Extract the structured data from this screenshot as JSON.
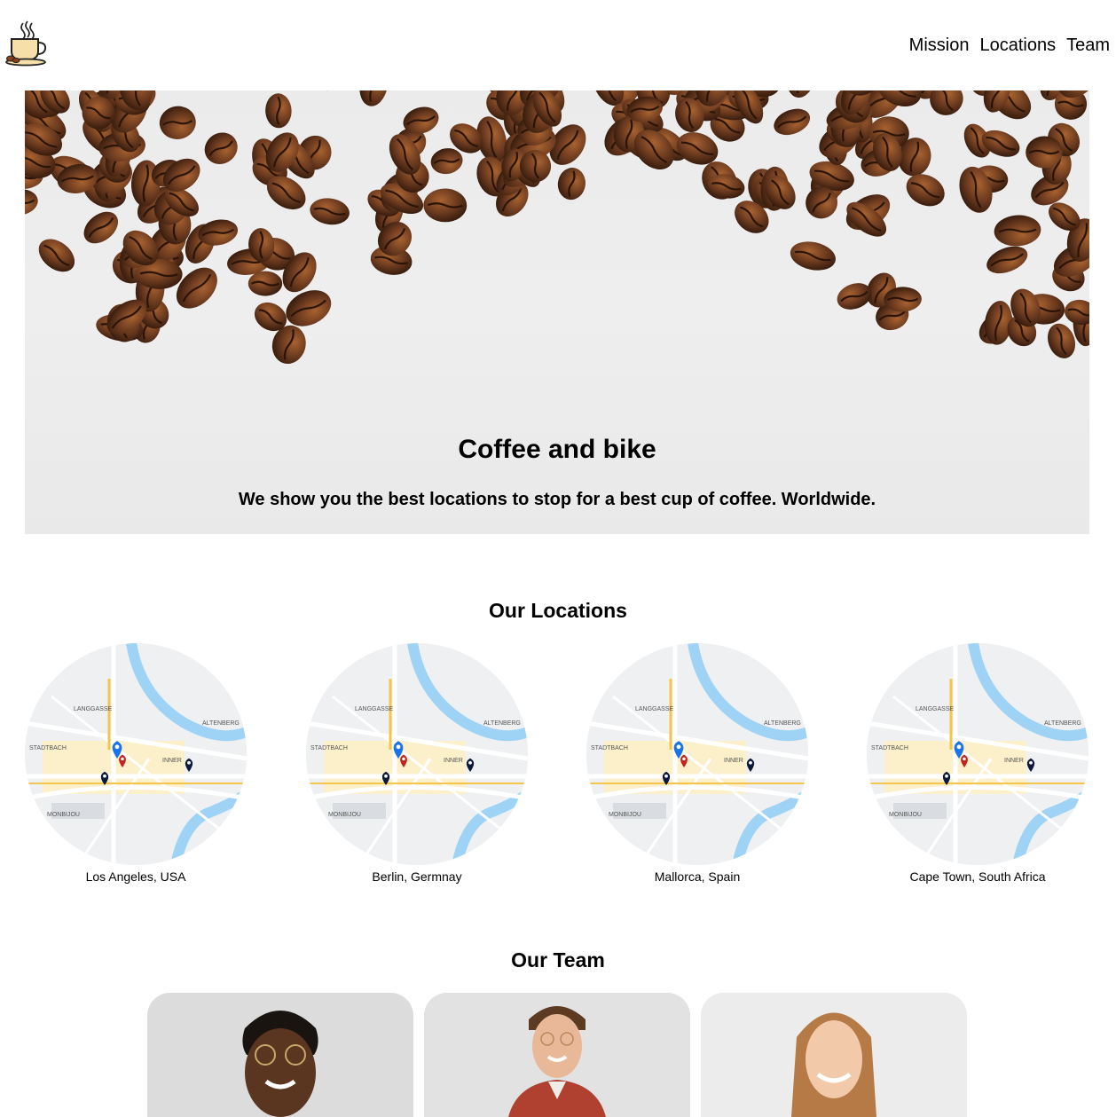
{
  "nav": {
    "items": [
      "Mission",
      "Locations",
      "Team"
    ]
  },
  "hero": {
    "title": "Coffee and bike",
    "subtitle": "We show you the best locations to stop for a best cup of coffee. Worldwide."
  },
  "locations": {
    "title": "Our Locations",
    "items": [
      "Los Angeles, USA",
      "Berlin, Germnay",
      "Mallorca, Spain",
      "Cape Town, South Africa"
    ]
  },
  "team": {
    "title": "Our Team"
  },
  "map_labels": {
    "langgasse": "LANGGASSE",
    "altenberg": "ALTENBERG",
    "stadtbach": "STADTBACH",
    "inner": "INNER",
    "monbijou": "MONBIJOU"
  },
  "colors": {
    "pin_blue": "#1a73e8",
    "pin_red": "#c5221f",
    "pin_navy": "#0b1a3a",
    "river": "#9fd3f5",
    "bean": "#6b3a1f"
  }
}
